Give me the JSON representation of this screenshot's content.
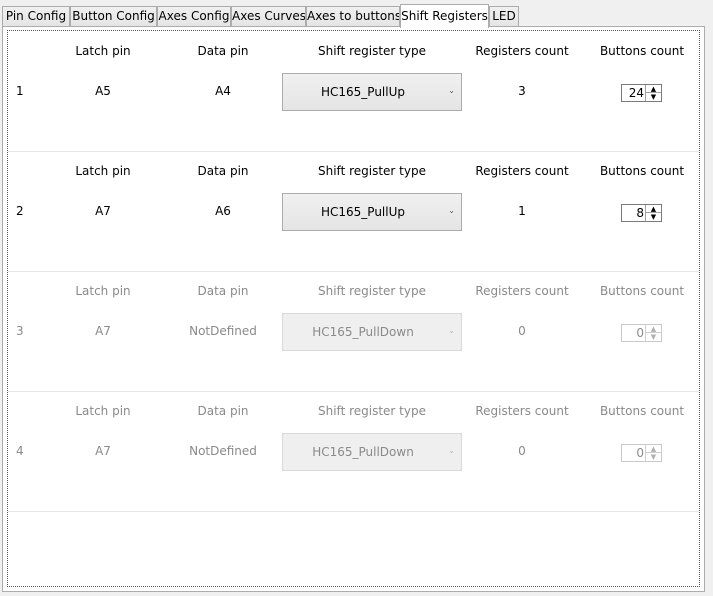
{
  "tabs": [
    {
      "label": "Pin Config"
    },
    {
      "label": "Button Config"
    },
    {
      "label": "Axes Config"
    },
    {
      "label": "Axes Curves"
    },
    {
      "label": "Axes to buttons"
    },
    {
      "label": "Shift Registers"
    },
    {
      "label": "LED"
    }
  ],
  "active_tab": "Shift Registers",
  "headers": {
    "latch_pin": "Latch pin",
    "data_pin": "Data pin",
    "shift_register_type": "Shift register type",
    "registers_count": "Registers count",
    "buttons_count": "Buttons count"
  },
  "rows": [
    {
      "index": "1",
      "latch_pin": "A5",
      "data_pin": "A4",
      "type": "HC165_PullUp",
      "registers_count": "3",
      "buttons_count": "24",
      "enabled": true
    },
    {
      "index": "2",
      "latch_pin": "A7",
      "data_pin": "A6",
      "type": "HC165_PullUp",
      "registers_count": "1",
      "buttons_count": "8",
      "enabled": true
    },
    {
      "index": "3",
      "latch_pin": "A7",
      "data_pin": "NotDefined",
      "type": "HC165_PullDown",
      "registers_count": "0",
      "buttons_count": "0",
      "enabled": false
    },
    {
      "index": "4",
      "latch_pin": "A7",
      "data_pin": "NotDefined",
      "type": "HC165_PullDown",
      "registers_count": "0",
      "buttons_count": "0",
      "enabled": false
    }
  ],
  "icons": {
    "dropdown": "chevron-down-icon",
    "spin_up": "triangle-up-icon",
    "spin_down": "triangle-down-icon"
  }
}
